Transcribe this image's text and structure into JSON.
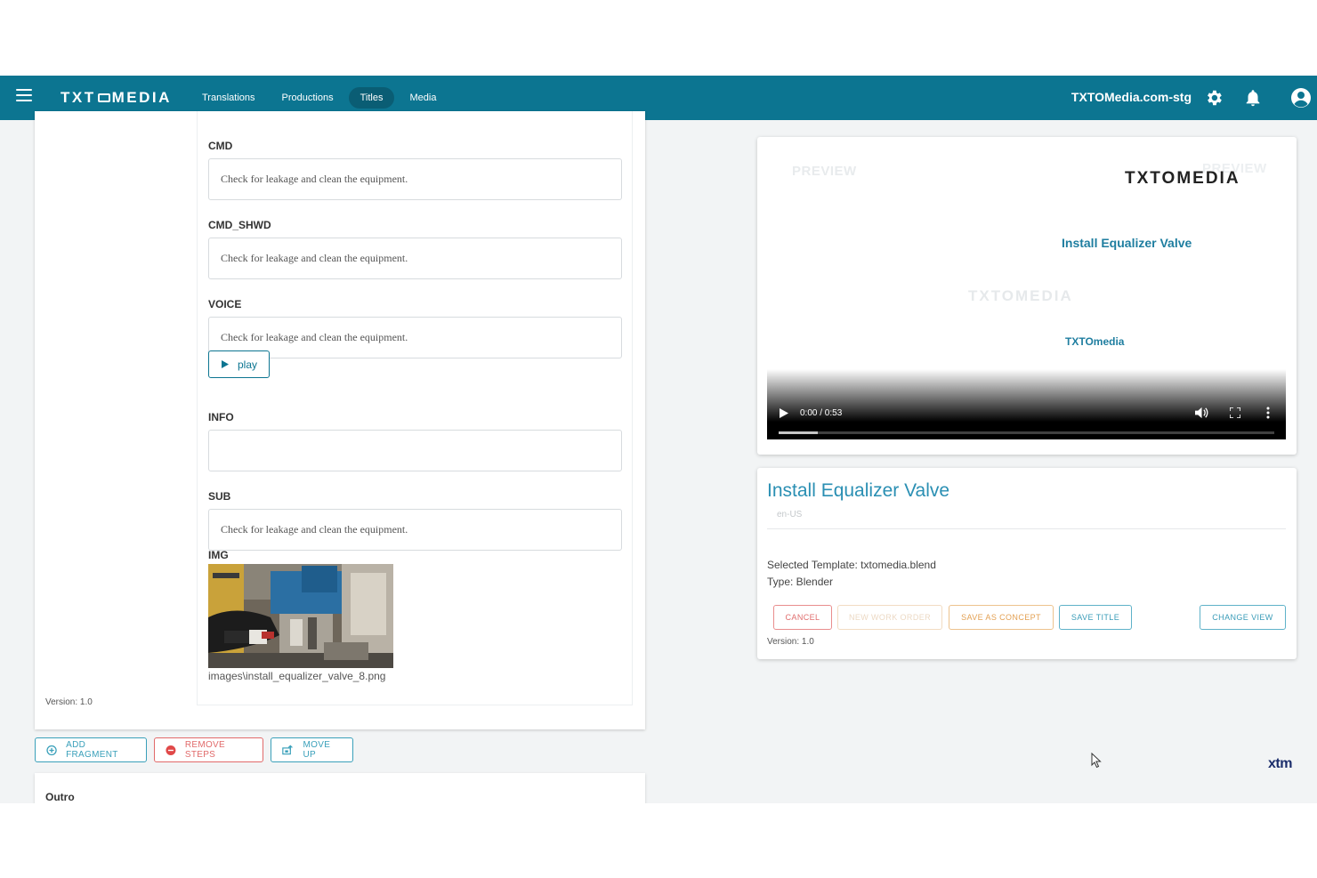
{
  "topbar": {
    "logo": "TXTOMEDIA",
    "nav": [
      {
        "label": "Translations",
        "active": false
      },
      {
        "label": "Productions",
        "active": false
      },
      {
        "label": "Titles",
        "active": true
      },
      {
        "label": "Media",
        "active": false
      }
    ],
    "site": "TXTOMedia.com-stg",
    "icons": [
      "menu-icon",
      "settings-icon",
      "bell-icon",
      "account-icon"
    ],
    "color": "#0c7591"
  },
  "fragment": {
    "fields": [
      {
        "label": "CMD",
        "value": "Check for leakage and clean the equipment."
      },
      {
        "label": "CMD_SHWD",
        "value": "Check for leakage and clean the equipment."
      },
      {
        "label": "VOICE",
        "value": "Check for leakage and clean the equipment."
      },
      {
        "label": "INFO",
        "value": ""
      },
      {
        "label": "SUB",
        "value": "Check for leakage and clean the equipment."
      }
    ],
    "play_label": "play",
    "img_label": "IMG",
    "img_path": "images\\install_equalizer_valve_8.png",
    "version": "Version: 1.0"
  },
  "actions": {
    "add_fragment": "ADD FRAGMENT",
    "remove_steps": "REMOVE STEPS",
    "move_up": "MOVE UP"
  },
  "outro": {
    "label": "Outro"
  },
  "preview": {
    "watermark_preview": "PREVIEW",
    "logo": "TXTOMEDIA",
    "title": "Install Equalizer Valve",
    "watermark_logo": "TXTOMEDIA",
    "brand": "TXTOmedia",
    "time": "0:00 / 0:53"
  },
  "info": {
    "title": "Install Equalizer Valve",
    "lang": "en-US",
    "template": "Selected Template: txtomedia.blend",
    "type": "Type: Blender",
    "version": "Version: 1.0",
    "buttons": {
      "cancel": "CANCEL",
      "new_work_order": "NEW WORK ORDER",
      "save_as_concept": "SAVE AS CONCEPT",
      "save_title": "SAVE TITLE",
      "change_view": "CHANGE VIEW"
    }
  },
  "footer_logo": "xtm"
}
